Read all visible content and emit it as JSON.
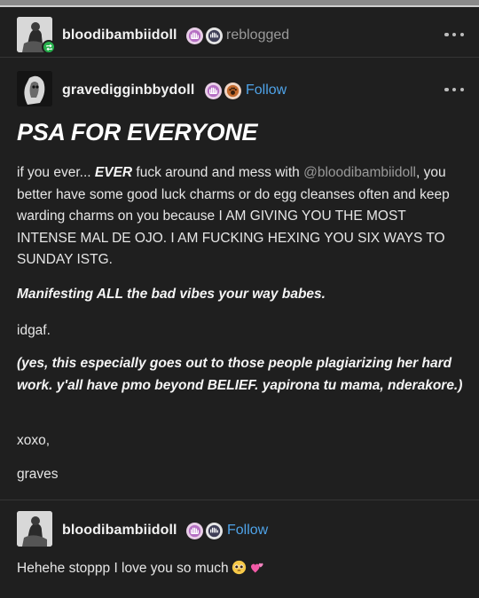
{
  "reblog_header": {
    "username": "bloodibambiidoll",
    "action": "reblogged"
  },
  "original_post": {
    "username": "gravedigginbbydoll",
    "follow": "Follow",
    "title": "PSA FOR EVERYONE",
    "p1": {
      "a": "if you ever... ",
      "b": "EVER",
      "c": " fuck around and mess with ",
      "mention": "@bloodibambiidoll",
      "d": ", you better have some good luck charms or do egg cleanses often and keep warding charms on you because I AM GIVING YOU THE MOST INTENSE MAL DE OJO. I AM FUCKING HEXING YOU SIX WAYS TO SUNDAY ISTG."
    },
    "p2": "Manifesting ALL the bad vibes your way babes.",
    "p3": "idgaf.",
    "p4": "(yes, this especially goes out to those people plagiarizing her hard work. y'all have pmo beyond BELIEF. yapirona tu mama, nderakore.)",
    "p5": "xoxo,",
    "p6": "graves"
  },
  "reply_post": {
    "username": "bloodibambiidoll",
    "follow": "Follow",
    "text": "Hehehe stoppp I love you so much",
    "emojis": [
      "pleading-face",
      "two-hearts"
    ]
  },
  "icons": {
    "reblog": "reblog-icon",
    "more": "more-options-icon",
    "badges": [
      "hand-badge",
      "paw-badge",
      "skull-badge"
    ]
  },
  "colors": {
    "background": "#1f1f1f",
    "follow": "#4fa3e8",
    "muted": "#9a9a9a",
    "reblog_green": "#27b14d"
  }
}
